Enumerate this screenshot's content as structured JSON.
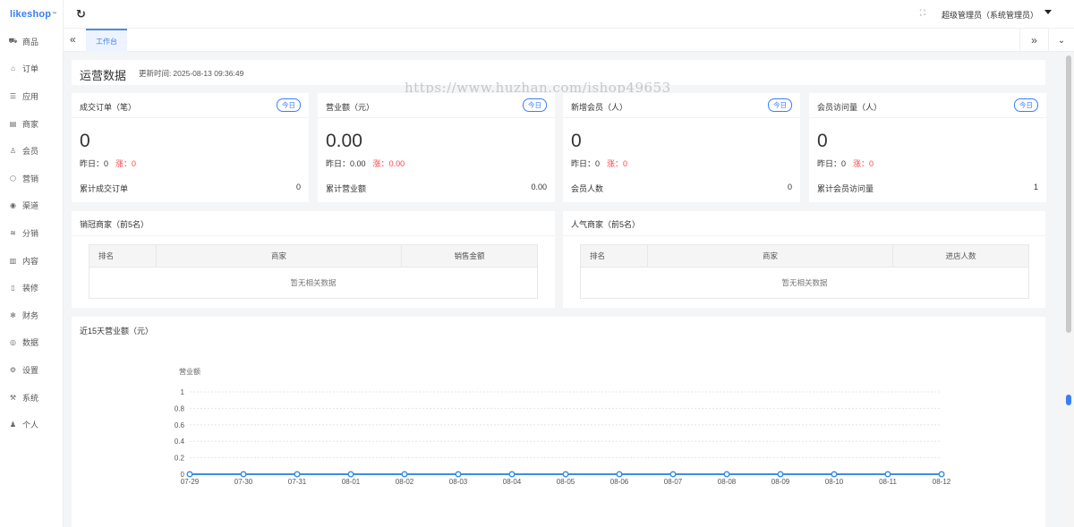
{
  "app": {
    "logo": "likeshop",
    "logo_tm": "™"
  },
  "sidebar": {
    "items": [
      {
        "label": "商品",
        "icon": "cart-icon",
        "glyph": "⛟"
      },
      {
        "label": "订单",
        "icon": "bell-icon",
        "glyph": "⌂"
      },
      {
        "label": "应用",
        "icon": "list-icon",
        "glyph": "☰"
      },
      {
        "label": "商家",
        "icon": "store-icon",
        "glyph": "▤"
      },
      {
        "label": "会员",
        "icon": "user-icon",
        "glyph": "♙"
      },
      {
        "label": "营销",
        "icon": "cube-icon",
        "glyph": "⬡"
      },
      {
        "label": "渠道",
        "icon": "channel-icon",
        "glyph": "◉"
      },
      {
        "label": "分销",
        "icon": "layers-icon",
        "glyph": "≋"
      },
      {
        "label": "内容",
        "icon": "book-icon",
        "glyph": "▥"
      },
      {
        "label": "装修",
        "icon": "phone-icon",
        "glyph": "▯"
      },
      {
        "label": "财务",
        "icon": "finance-icon",
        "glyph": "✻"
      },
      {
        "label": "数据",
        "icon": "globe-icon",
        "glyph": "◎"
      },
      {
        "label": "设置",
        "icon": "gear-icon",
        "glyph": "⚙"
      },
      {
        "label": "系统",
        "icon": "system-icon",
        "glyph": "⚒"
      },
      {
        "label": "个人",
        "icon": "person-icon",
        "glyph": "♟"
      }
    ]
  },
  "header": {
    "refresh_glyph": "↻",
    "fullscreen_glyph": "⛶",
    "user": "超级管理员（系统管理员）"
  },
  "tabs": {
    "left_glyph": "«",
    "active": "工作台",
    "right_glyph": "»",
    "dropdown_glyph": "⌄"
  },
  "ops": {
    "title": "运营数据",
    "update_label": "更新时间:",
    "update_time": "2025-08-13 09:36:49"
  },
  "watermark": "https://www.huzhan.com/ishop49653",
  "stats": [
    {
      "title": "成交订单（笔）",
      "tag": "今日",
      "value": "0",
      "yest_label": "昨日：",
      "yest": "0",
      "rise_label": "涨：",
      "rise": "0",
      "total_label": "累计成交订单",
      "total": "0"
    },
    {
      "title": "营业额（元）",
      "tag": "今日",
      "value": "0.00",
      "yest_label": "昨日：",
      "yest": "0.00",
      "rise_label": "涨：",
      "rise": "0.00",
      "total_label": "累计营业额",
      "total": "0.00"
    },
    {
      "title": "新增会员（人）",
      "tag": "今日",
      "value": "0",
      "yest_label": "昨日：",
      "yest": "0",
      "rise_label": "涨：",
      "rise": "0",
      "total_label": "会员人数",
      "total": "0"
    },
    {
      "title": "会员访问量（人）",
      "tag": "今日",
      "value": "0",
      "yest_label": "昨日：",
      "yest": "0",
      "rise_label": "涨：",
      "rise": "0",
      "total_label": "累计会员访问量",
      "total": "1"
    }
  ],
  "rank_sales": {
    "title": "销冠商家（前5名）",
    "headers": [
      "排名",
      "商家",
      "销售金额"
    ],
    "empty": "暂无相关数据"
  },
  "rank_popular": {
    "title": "人气商家（前5名）",
    "headers": [
      "排名",
      "商家",
      "进店人数"
    ],
    "empty": "暂无相关数据"
  },
  "trend": {
    "title": "近15天营业额（元）"
  },
  "chart_data": {
    "type": "line",
    "title": "",
    "ylabel": "营业额",
    "xlabel": "",
    "x": [
      "07-29",
      "07-30",
      "07-31",
      "08-01",
      "08-02",
      "08-03",
      "08-04",
      "08-05",
      "08-06",
      "08-07",
      "08-08",
      "08-09",
      "08-10",
      "08-11",
      "08-12"
    ],
    "series": [
      {
        "values": [
          0,
          0,
          0,
          0,
          0,
          0,
          0,
          0,
          0,
          0,
          0,
          0,
          0,
          0,
          0
        ]
      }
    ],
    "ylim": [
      0,
      1
    ],
    "yticks": [
      "0",
      "0.2",
      "0.4",
      "0.6",
      "0.8",
      "1"
    ],
    "line_color": "#3a8ee6",
    "grid": true
  }
}
